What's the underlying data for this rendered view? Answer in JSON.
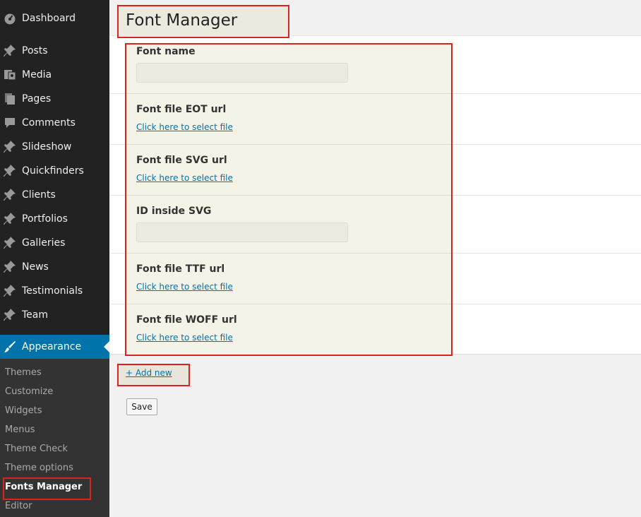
{
  "sidebar": {
    "items": [
      {
        "label": "Dashboard",
        "icon": "dashboard-icon"
      },
      {
        "label": "Posts",
        "icon": "pin-icon"
      },
      {
        "label": "Media",
        "icon": "media-icon"
      },
      {
        "label": "Pages",
        "icon": "pages-icon"
      },
      {
        "label": "Comments",
        "icon": "comment-icon"
      },
      {
        "label": "Slideshow",
        "icon": "pin-icon"
      },
      {
        "label": "Quickfinders",
        "icon": "pin-icon"
      },
      {
        "label": "Clients",
        "icon": "pin-icon"
      },
      {
        "label": "Portfolios",
        "icon": "pin-icon"
      },
      {
        "label": "Galleries",
        "icon": "pin-icon"
      },
      {
        "label": "News",
        "icon": "pin-icon"
      },
      {
        "label": "Testimonials",
        "icon": "pin-icon"
      },
      {
        "label": "Team",
        "icon": "pin-icon"
      },
      {
        "label": "Appearance",
        "icon": "brush-icon"
      }
    ],
    "submenu": [
      {
        "label": "Themes"
      },
      {
        "label": "Customize"
      },
      {
        "label": "Widgets"
      },
      {
        "label": "Menus"
      },
      {
        "label": "Theme Check"
      },
      {
        "label": "Theme options"
      },
      {
        "label": "Fonts Manager"
      },
      {
        "label": "Editor"
      }
    ]
  },
  "page": {
    "title": "Font Manager"
  },
  "form": {
    "font_name": {
      "label": "Font name",
      "value": ""
    },
    "eot": {
      "label": "Font file EOT url",
      "link": "Click here to select file"
    },
    "svg": {
      "label": "Font file SVG url",
      "link": "Click here to select file"
    },
    "svg_id": {
      "label": "ID inside SVG",
      "value": ""
    },
    "ttf": {
      "label": "Font file TTF url",
      "link": "Click here to select file"
    },
    "woff": {
      "label": "Font file WOFF url",
      "link": "Click here to select file"
    }
  },
  "actions": {
    "add_new": "+ Add new",
    "save": "Save"
  },
  "colors": {
    "sidebar_bg": "#222222",
    "active_menu": "#0073aa",
    "link": "#0073aa",
    "annotation": "#d9231d"
  }
}
